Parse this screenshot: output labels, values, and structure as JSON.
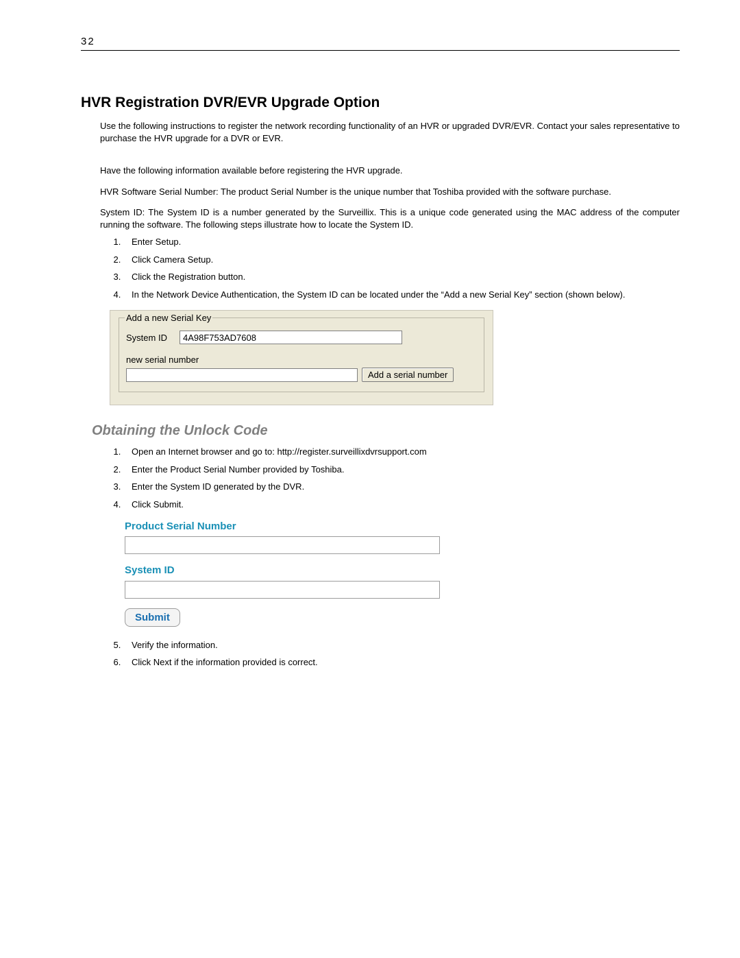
{
  "page_number": "32",
  "heading": "HVR Registration DVR/EVR Upgrade Option",
  "intro": "Use the following instructions to register the network recording functionality of an HVR or upgraded DVR/EVR.  Contact your sales representative to purchase the HVR upgrade for a DVR or EVR.",
  "pre_info": "Have the following information available before registering the HVR upgrade.",
  "serial_para": "HVR Software Serial Number: The product Serial Number is the unique number that Toshiba provided with the software purchase.",
  "sysid_para": "System ID: The System ID is a number generated by the Surveillix. This is a unique code generated using the MAC address of the computer running the software. The following steps illustrate how to locate the System ID.",
  "steps_a": [
    "Enter Setup.",
    "Click Camera Setup.",
    "Click the Registration button.",
    "In the Network Device Authentication, the System ID can be located under the “Add a new Serial Key” section (shown below)."
  ],
  "winbox": {
    "legend": "Add a new Serial Key",
    "system_id_label": "System ID",
    "system_id_value": "4A98F753AD7608",
    "new_serial_label": "new serial number",
    "new_serial_value": "",
    "button": "Add a serial number"
  },
  "subheading": "Obtaining the Unlock Code",
  "steps_b": [
    "Open an Internet browser and go to: http://register.surveillixdvrsupport.com",
    "Enter the Product Serial Number provided by Toshiba.",
    "Enter the System ID generated by the DVR.",
    "Click Submit."
  ],
  "webform": {
    "psn_label": "Product Serial Number",
    "psn_value": "",
    "sysid_label": "System ID",
    "sysid_value": "",
    "submit": "Submit"
  },
  "steps_c": [
    "Verify the information.",
    "Click Next if the information provided is correct."
  ]
}
